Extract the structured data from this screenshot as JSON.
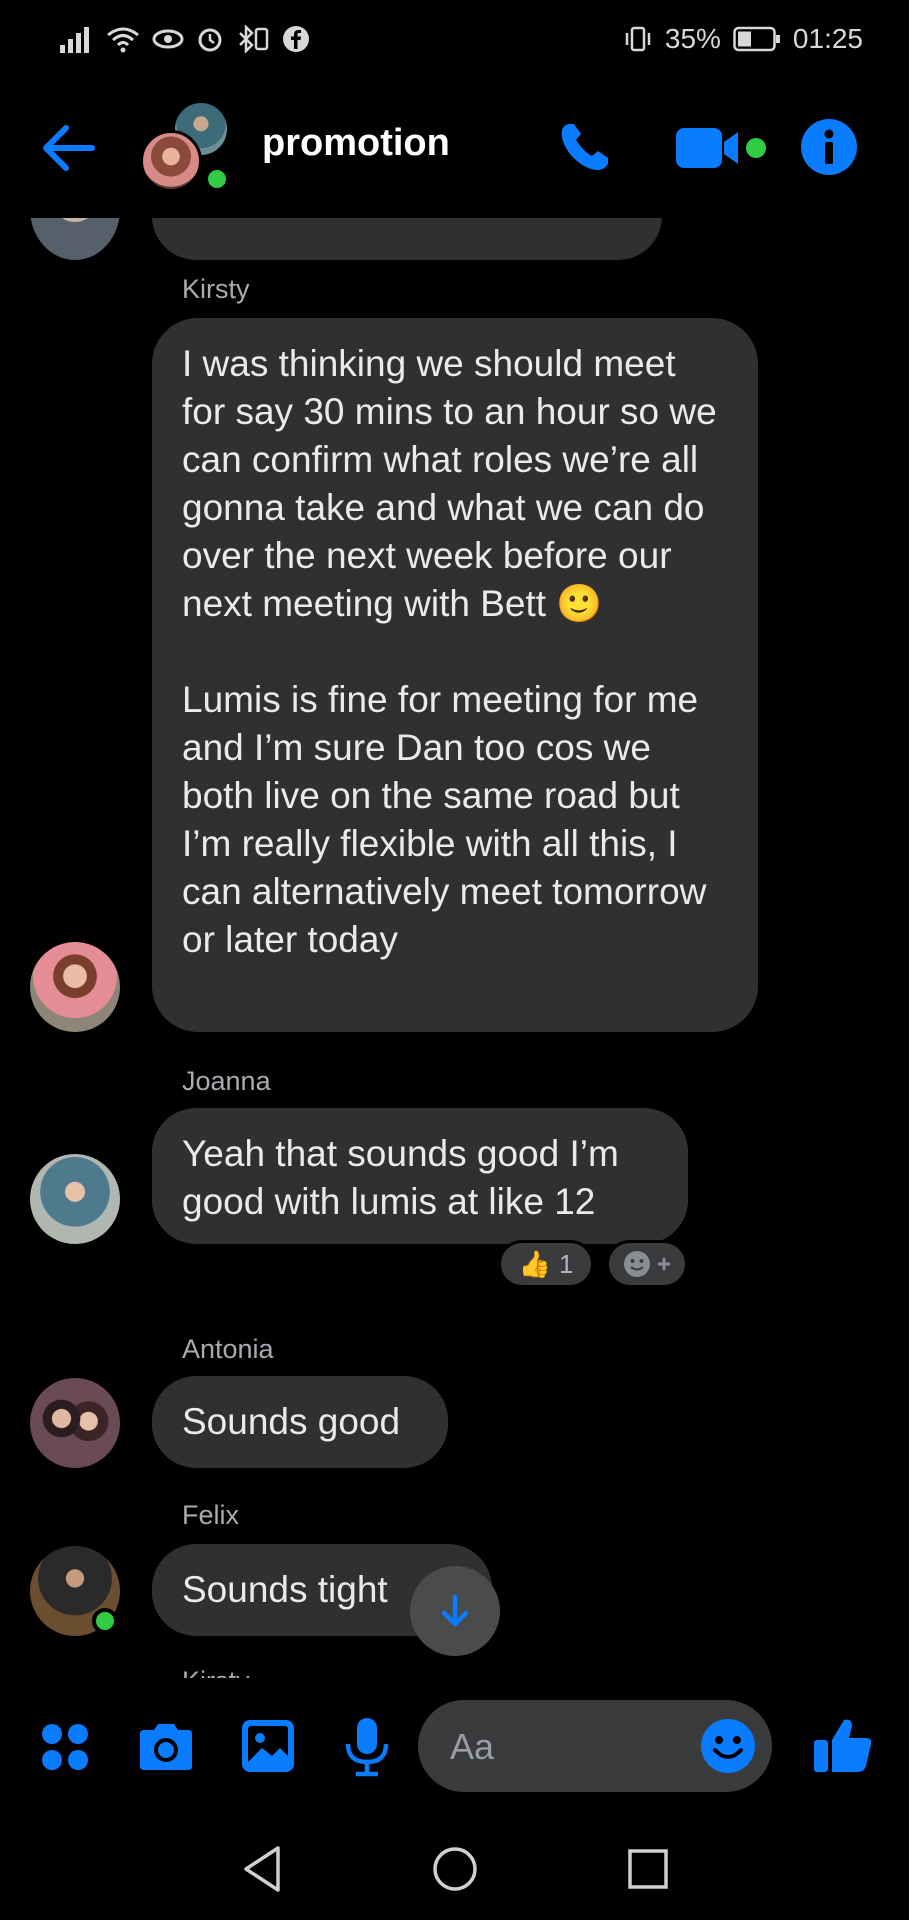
{
  "status_bar": {
    "battery": "35%",
    "time": "01:25"
  },
  "header": {
    "title": "promotion"
  },
  "messages": [
    {
      "sender": "Kirsty",
      "text": "I was thinking we should meet for say 30 mins to an hour so we can confirm what roles we’re all gonna take and what we can do over the next week before our next meeting with Bett 🙂\n\nLumis is fine for meeting for me and I’m sure Dan too cos we both live on the same road but I’m really flexible with all this, I can alternatively meet tomorrow or later today"
    },
    {
      "sender": "Joanna",
      "text": "Yeah that sounds good I’m good with lumis at like 12",
      "reaction": {
        "emoji": "👍",
        "count": "1"
      }
    },
    {
      "sender": "Antonia",
      "text": "Sounds good"
    },
    {
      "sender": "Felix",
      "text": "Sounds tight"
    },
    {
      "sender": "Kirsty"
    }
  ],
  "composer": {
    "placeholder": "Aa"
  },
  "colors": {
    "accent": "#0a7cff",
    "bubble": "#303030",
    "online": "#31cc46",
    "background": "#000000"
  },
  "icons": [
    "back-arrow-icon",
    "phone-icon",
    "video-icon",
    "info-icon",
    "apps-icon",
    "camera-icon",
    "gallery-icon",
    "mic-icon",
    "emoji-icon",
    "thumbs-up-icon",
    "scroll-down-icon"
  ]
}
